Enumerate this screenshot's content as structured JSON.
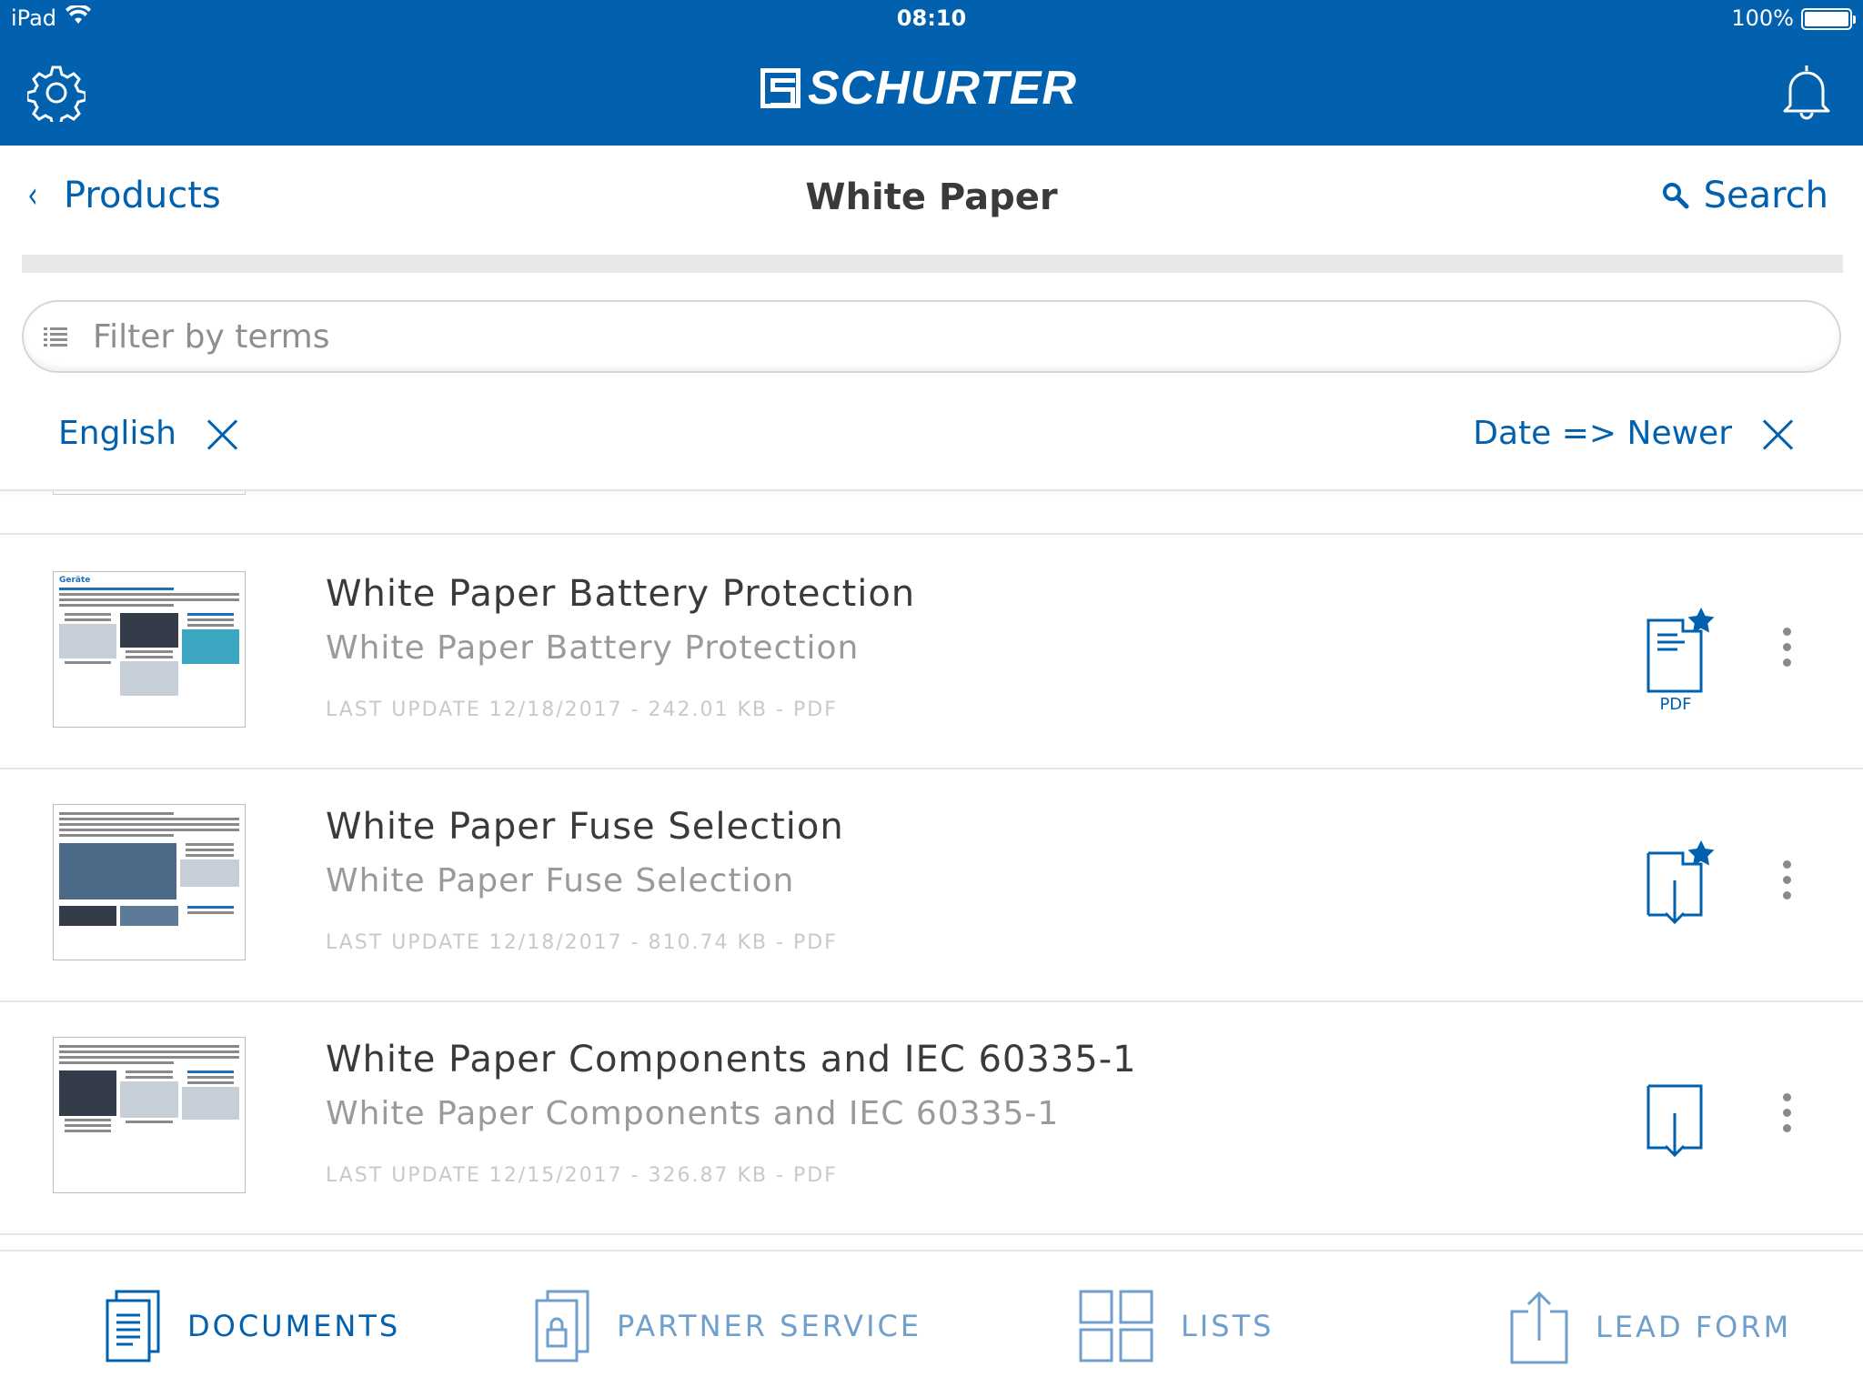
{
  "status_bar": {
    "device": "iPad",
    "time": "08:10",
    "battery": "100%"
  },
  "header": {
    "brand": "SCHURTER",
    "settings_icon": "gear-icon",
    "notifications_icon": "bell-icon",
    "color": "#0161ae"
  },
  "nav": {
    "back_label": "Products",
    "title": "White Paper",
    "search_label": "Search"
  },
  "filter": {
    "placeholder": "Filter by terms",
    "value": ""
  },
  "active_filters": {
    "language": "English",
    "sort": "Date => Newer"
  },
  "documents": [
    {
      "title": "White Paper Battery Protection",
      "subtitle": "White Paper Battery Protection",
      "meta": "LAST UPDATE 12/18/2017 - 242.01 KB - PDF",
      "thumb_heading": "Geräte",
      "action": "open-pdf",
      "action_label": "PDF",
      "favorite": true
    },
    {
      "title": "White Paper Fuse Selection",
      "subtitle": "White Paper Fuse Selection",
      "meta": "LAST UPDATE 12/18/2017 - 810.74 KB - PDF",
      "action": "download",
      "favorite": true
    },
    {
      "title": "White Paper Components and IEC 60335-1",
      "subtitle": "White Paper Components and IEC 60335-1",
      "meta": "LAST UPDATE 12/15/2017 - 326.87 KB - PDF",
      "action": "download",
      "favorite": false
    }
  ],
  "tabs": [
    {
      "label": "DOCUMENTS",
      "icon": "documents-icon",
      "active": true
    },
    {
      "label": "PARTNER SERVICE",
      "icon": "partner-service-icon",
      "active": false
    },
    {
      "label": "LISTS",
      "icon": "lists-grid-icon",
      "active": false
    },
    {
      "label": "LEAD FORM",
      "icon": "lead-form-share-icon",
      "active": false
    }
  ]
}
